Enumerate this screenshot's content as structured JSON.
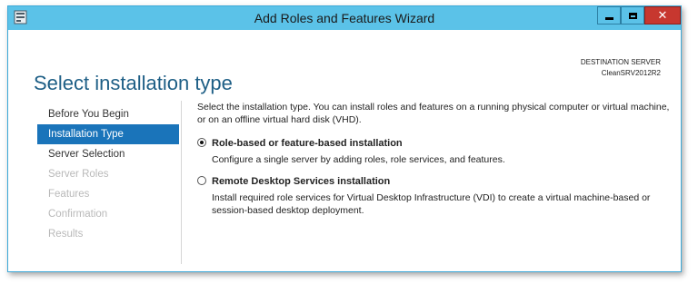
{
  "window": {
    "title": "Add Roles and Features Wizard"
  },
  "page": {
    "heading": "Select installation type"
  },
  "destination": {
    "label": "DESTINATION SERVER",
    "server": "CleanSRV2012R2"
  },
  "nav": [
    {
      "label": "Before You Begin",
      "state": "normal"
    },
    {
      "label": "Installation Type",
      "state": "active"
    },
    {
      "label": "Server Selection",
      "state": "normal"
    },
    {
      "label": "Server Roles",
      "state": "disabled"
    },
    {
      "label": "Features",
      "state": "disabled"
    },
    {
      "label": "Confirmation",
      "state": "disabled"
    },
    {
      "label": "Results",
      "state": "disabled"
    }
  ],
  "content": {
    "intro": "Select the installation type. You can install roles and features on a running physical computer or virtual machine, or on an offline virtual hard disk (VHD).",
    "options": [
      {
        "title": "Role-based or feature-based installation",
        "desc": "Configure a single server by adding roles, role services, and features.",
        "selected": true
      },
      {
        "title": "Remote Desktop Services installation",
        "desc": "Install required role services for Virtual Desktop Infrastructure (VDI) to create a virtual machine-based or session-based desktop deployment.",
        "selected": false
      }
    ]
  },
  "colors": {
    "titlebar": "#5bc2e8",
    "accent": "#1a74ba",
    "heading": "#1e5f86",
    "close": "#c7372f"
  }
}
